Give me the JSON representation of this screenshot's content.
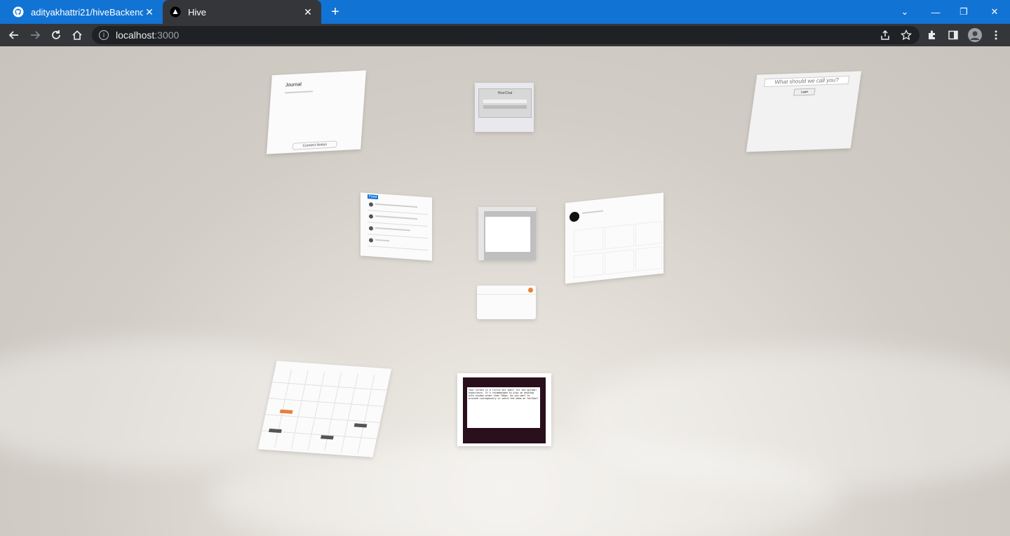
{
  "tabs": [
    {
      "title": "adityakhattri21/hiveBackend",
      "icon": "github-icon",
      "active": false
    },
    {
      "title": "Hive",
      "icon": "hive-icon",
      "active": true
    }
  ],
  "address": {
    "host": "localhost",
    "port": ":3000"
  },
  "panels": {
    "journal": {
      "title": "Journal",
      "footer_button": "Connect Notion"
    },
    "chat_login": {
      "title": "HiveChat"
    },
    "name_prompt": {
      "placeholder": "What should we call you?",
      "button": "Login"
    },
    "feed": {
      "badge": "Feed"
    },
    "video_notice": {
      "text": "Your screen is a little bit small for the optimal experience. It's recommended to play on desktop with window wider than 700px. Do you want to proceed courageously or watch the demo on YouTube?"
    }
  }
}
